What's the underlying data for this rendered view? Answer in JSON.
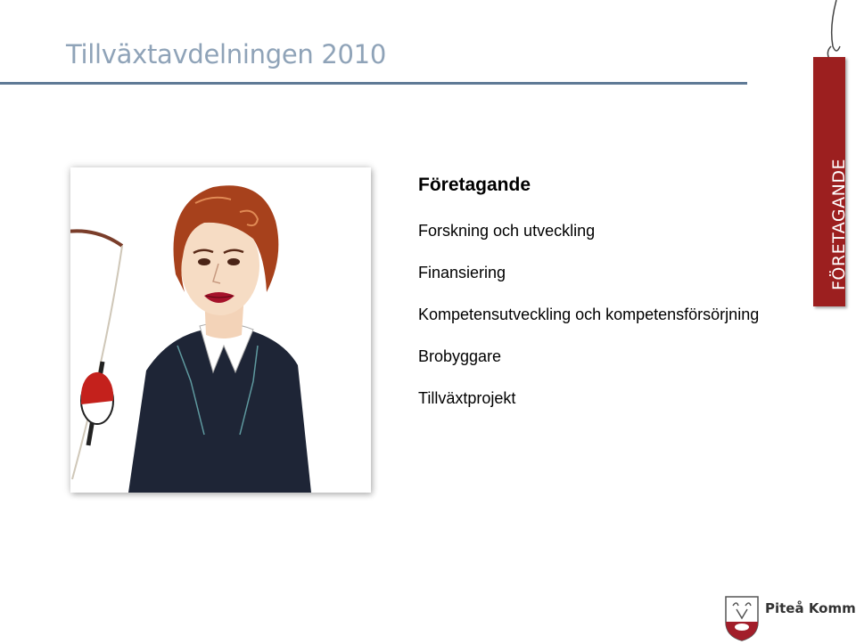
{
  "slide": {
    "title": "Tillväxtavdelningen 2010"
  },
  "content": {
    "heading": "Företagande",
    "items": [
      "Forskning och utveckling",
      "Finansiering",
      "Kompetensutveckling och kompetensförsörjning",
      "Brobyggare",
      "Tillväxtprojekt"
    ]
  },
  "tag": {
    "label": "FÖRETAGANDE",
    "color": "#9c1f1f"
  },
  "logo": {
    "name": "Piteå Kommun"
  },
  "colors": {
    "title": "#8fa3b8",
    "rule": "#5f7a96"
  }
}
